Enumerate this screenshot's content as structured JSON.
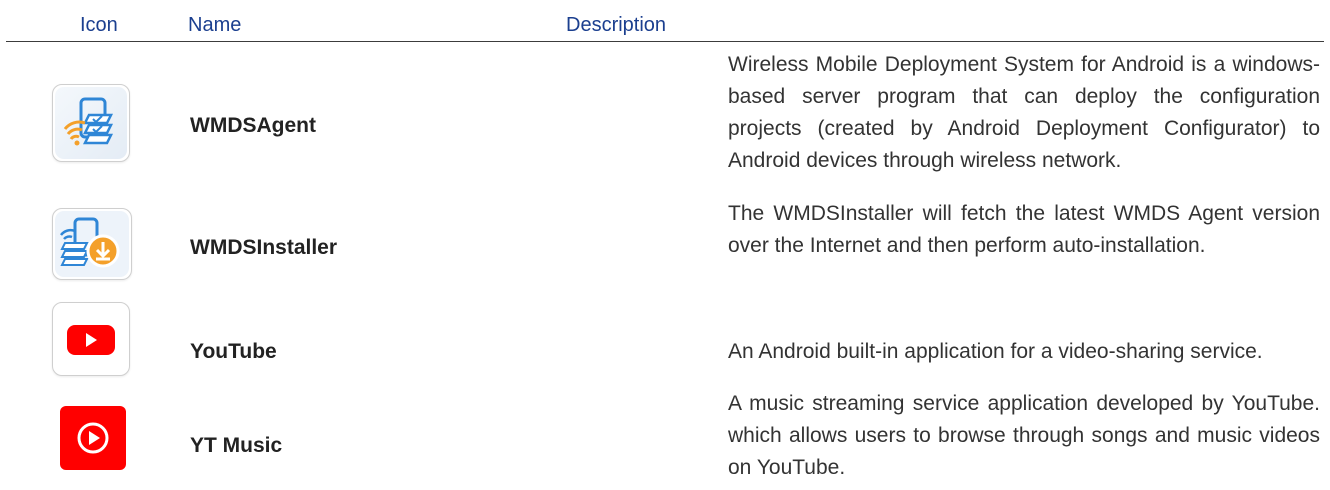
{
  "table": {
    "headers": {
      "icon": "Icon",
      "name": "Name",
      "description": "Description"
    },
    "rows": [
      {
        "icon": "wmds-agent-icon",
        "name": "WMDSAgent",
        "description": "Wireless Mobile Deployment System for Android is a windows-based server program that can deploy the configuration projects (created by Android Deployment Configurator) to Android devices through wireless network."
      },
      {
        "icon": "wmds-installer-icon",
        "name": "WMDSInstaller",
        "description": "The WMDSInstaller will fetch the latest WMDS Agent version over the Internet and then perform auto-installation."
      },
      {
        "icon": "youtube-icon",
        "name": "YouTube",
        "description": "An Android built-in application for a video-sharing service."
      },
      {
        "icon": "yt-music-icon",
        "name": "YT Music",
        "description": "A music streaming service application developed by YouTube. which allows users to browse through songs and music videos on YouTube."
      }
    ]
  },
  "colors": {
    "header_text": "#1b3f8f",
    "youtube_red": "#ff0000",
    "wmds_orange": "#f4a02a",
    "wmds_blue": "#2f86d6"
  }
}
